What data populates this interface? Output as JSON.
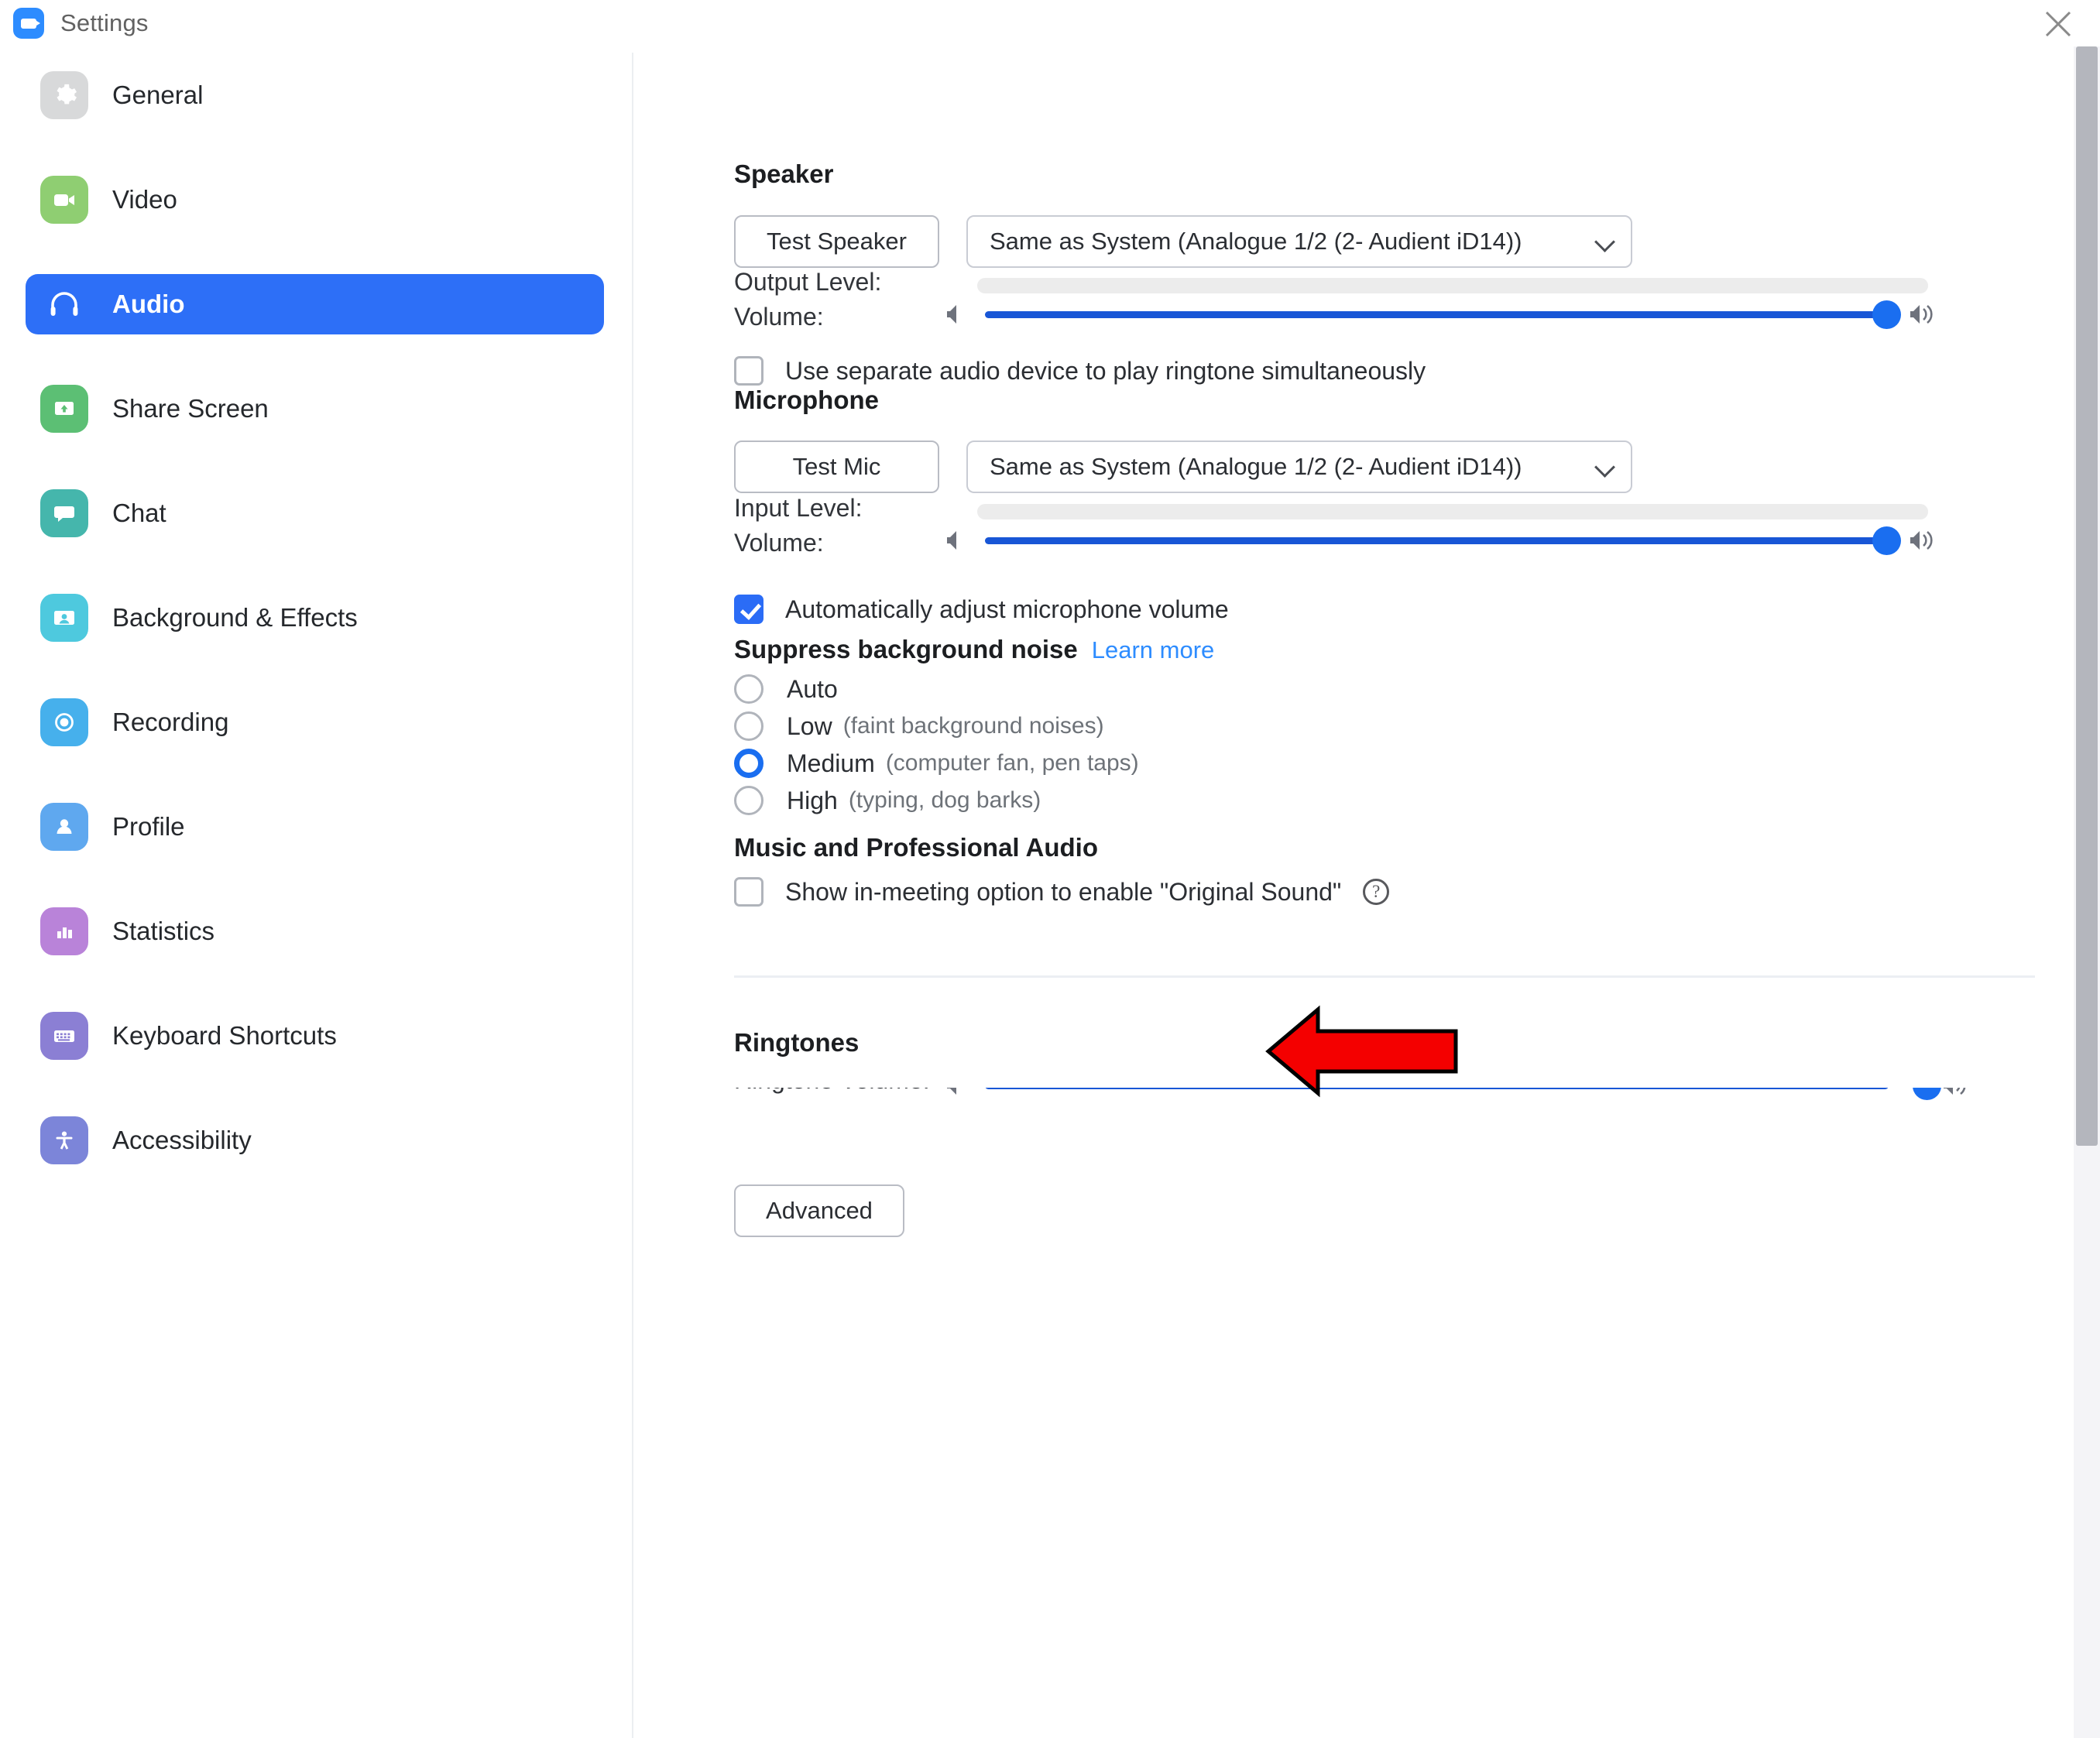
{
  "window": {
    "title": "Settings",
    "logo_icon": "zoom-camera-icon",
    "close_icon": "close-icon"
  },
  "sidebar": {
    "items": [
      {
        "label": "General",
        "icon": "gear-icon",
        "color": "#d8d9da",
        "active": false
      },
      {
        "label": "Video",
        "icon": "video-camera-icon",
        "color": "#8fce72",
        "active": false
      },
      {
        "label": "Audio",
        "icon": "headphones-icon",
        "color": "#2d6ff7",
        "active": true
      },
      {
        "label": "Share Screen",
        "icon": "share-screen-icon",
        "color": "#5cbf74",
        "active": false
      },
      {
        "label": "Chat",
        "icon": "chat-bubble-icon",
        "color": "#45b6ac",
        "active": false
      },
      {
        "label": "Background & Effects",
        "icon": "person-frame-icon",
        "color": "#4ec9de",
        "active": false
      },
      {
        "label": "Recording",
        "icon": "record-circle-icon",
        "color": "#46b0ec",
        "active": false
      },
      {
        "label": "Profile",
        "icon": "person-icon",
        "color": "#5fa8ef",
        "active": false
      },
      {
        "label": "Statistics",
        "icon": "bar-chart-icon",
        "color": "#b983d9",
        "active": false
      },
      {
        "label": "Keyboard Shortcuts",
        "icon": "keyboard-icon",
        "color": "#8b7fd4",
        "active": false
      },
      {
        "label": "Accessibility",
        "icon": "accessibility-icon",
        "color": "#7c85d9",
        "active": false
      }
    ]
  },
  "speaker": {
    "heading": "Speaker",
    "test_button": "Test Speaker",
    "device": "Same as System (Analogue 1/2 (2- Audient iD14))",
    "output_level_label": "Output Level:",
    "output_level_value": 0,
    "volume_label": "Volume:",
    "volume_value": 100,
    "ringtone_checkbox": {
      "label": "Use separate audio device to play ringtone simultaneously",
      "checked": false
    }
  },
  "microphone": {
    "heading": "Microphone",
    "test_button": "Test Mic",
    "device": "Same as System (Analogue 1/2 (2- Audient iD14))",
    "input_level_label": "Input Level:",
    "input_level_value": 0,
    "volume_label": "Volume:",
    "volume_value": 100,
    "auto_adjust": {
      "label": "Automatically adjust microphone volume",
      "checked": true
    }
  },
  "suppress_noise": {
    "heading": "Suppress background noise",
    "learn_more": "Learn more",
    "selected": "Medium",
    "options": [
      {
        "label": "Auto",
        "hint": "",
        "selected": false
      },
      {
        "label": "Low",
        "hint": "(faint background noises)",
        "selected": false
      },
      {
        "label": "Medium",
        "hint": "(computer fan, pen taps)",
        "selected": true
      },
      {
        "label": "High",
        "hint": "(typing, dog barks)",
        "selected": false
      }
    ]
  },
  "music_audio": {
    "heading": "Music and Professional Audio",
    "original_sound": {
      "label": "Show in-meeting option to enable \"Original Sound\"",
      "checked": false,
      "help_icon": "question-mark-icon",
      "help_glyph": "?"
    }
  },
  "ringtones": {
    "heading": "Ringtones"
  },
  "footer": {
    "advanced_button": "Advanced"
  },
  "annotation": {
    "type": "arrow",
    "direction": "left",
    "color": "#f40000",
    "outline": "#000000",
    "points_at": "Low (faint background noises)"
  },
  "colors": {
    "accent": "#2d6ff7",
    "slider": "#1a6ef0",
    "link": "#2d8cff",
    "annotation_red": "#f40000"
  }
}
